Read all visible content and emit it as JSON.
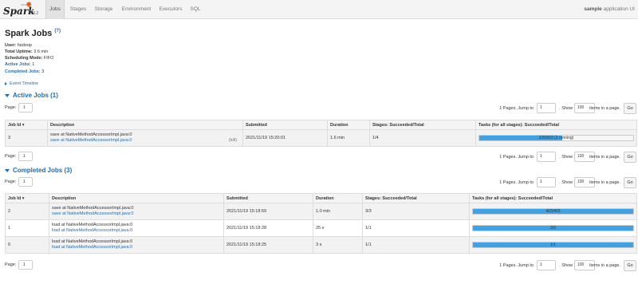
{
  "navbar": {
    "logo_text": "Spark",
    "logo_small": "APACHE",
    "version": "3.3.2",
    "tabs": [
      {
        "label": "Jobs",
        "active": true
      },
      {
        "label": "Stages",
        "active": false
      },
      {
        "label": "Storage",
        "active": false
      },
      {
        "label": "Environment",
        "active": false
      },
      {
        "label": "Executors",
        "active": false
      },
      {
        "label": "SQL",
        "active": false
      }
    ],
    "app_name_bold": "sample",
    "app_name_suffix": " application UI"
  },
  "page": {
    "title": "Spark Jobs",
    "help": "(?)",
    "summary": {
      "user_label": "User:",
      "user_value": " hadoop",
      "uptime_label": "Total Uptime:",
      "uptime_value": " 3.6 min",
      "mode_label": "Scheduling Mode:",
      "mode_value": " FIFO",
      "active_label": "Active Jobs:",
      "active_value": " 1",
      "completed_label": "Completed Jobs:",
      "completed_value": " 3"
    },
    "event_timeline": "Event Timeline"
  },
  "pager": {
    "page_label": "Page:",
    "page_value": "1",
    "pages_text": "1 Pages. Jump to",
    "jump_value": "1",
    "show_text": ". Show",
    "show_value": "100",
    "items_text": "items in a page.",
    "go_label": "Go"
  },
  "active_jobs": {
    "heading": "Active Jobs (1)",
    "headers": [
      "Job Id ▾",
      "Description",
      "Submitted",
      "Duration",
      "Stages: Succeeded/Total",
      "Tasks (for all stages): Succeeded/Total"
    ],
    "rows": [
      {
        "id": "3",
        "desc_top": "save at NativeMethodAccessorImpl.java:0",
        "desc_link": "save at NativeMethodAccessorImpl.java:0",
        "kill": "(kill)",
        "submitted": "2021/11/19 15:20:01",
        "duration": "1.6 min",
        "stages": "1/4",
        "tasks_text": "326/603 (2 running)",
        "progress": 0.54
      }
    ]
  },
  "completed_jobs": {
    "heading": "Completed Jobs (3)",
    "headers": [
      "Job Id ▾",
      "Description",
      "Submitted",
      "Duration",
      "Stages: Succeeded/Total",
      "Tasks (for all stages): Succeeded/Total"
    ],
    "rows": [
      {
        "id": "2",
        "desc_top": "save at NativeMethodAccessorImpl.java:0",
        "desc_link": "save at NativeMethodAccessorImpl.java:0",
        "submitted": "2021/11/19 15:18:59",
        "duration": "1.0 min",
        "stages": "3/3",
        "tasks_text": "403/403",
        "progress": 1.0
      },
      {
        "id": "1",
        "desc_top": "load at NativeMethodAccessorImpl.java:0",
        "desc_link": "load at NativeMethodAccessorImpl.java:0",
        "submitted": "2021/11/19 15:18:28",
        "duration": "25 s",
        "stages": "1/1",
        "tasks_text": "3/3",
        "progress": 1.0
      },
      {
        "id": "0",
        "desc_top": "load at NativeMethodAccessorImpl.java:0",
        "desc_link": "load at NativeMethodAccessorImpl.java:0",
        "submitted": "2021/11/19 15:18:25",
        "duration": "3 s",
        "stages": "1/1",
        "tasks_text": "1/1",
        "progress": 1.0
      }
    ]
  },
  "colors": {
    "accent": "#1f6db3",
    "progress": "#3ea3e6",
    "logo_star": "#e25a1c"
  }
}
